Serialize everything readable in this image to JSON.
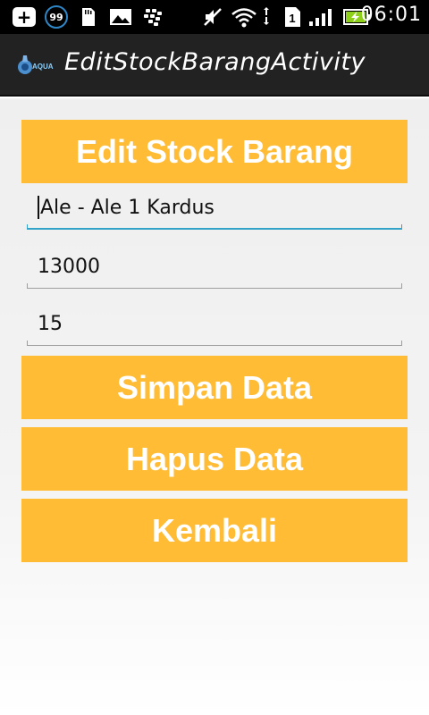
{
  "status_bar": {
    "notification_count": "99",
    "time": "06:01",
    "icons": [
      "plus-icon",
      "badge-99-icon",
      "sd-card-icon",
      "image-icon",
      "bbm-icon",
      "mute-icon",
      "wifi-icon",
      "sim-icon",
      "signal-icon",
      "battery-charging-icon"
    ]
  },
  "action_bar": {
    "title": "EditStockBarangActivity",
    "logo": "AQUA"
  },
  "form": {
    "heading": "Edit Stock Barang",
    "name_value": "Ale - Ale 1 Kardus",
    "price_value": "13000",
    "qty_value": "15"
  },
  "buttons": {
    "save_label": "Simpan Data",
    "delete_label": "Hapus Data",
    "back_label": "Kembali"
  },
  "colors": {
    "accent": "#ffbc34",
    "focus_line": "#33a3c8",
    "actionbar_bg": "#222222"
  }
}
